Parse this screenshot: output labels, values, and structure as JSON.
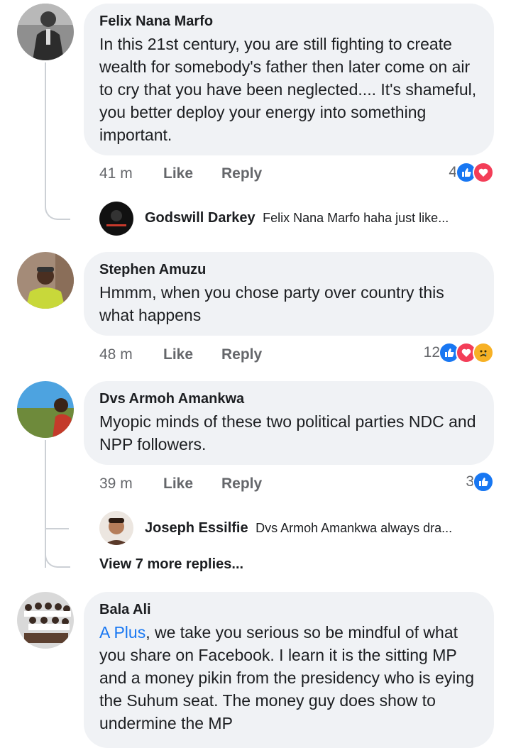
{
  "comments": [
    {
      "author": "Felix Nana Marfo",
      "text": "In this 21st century, you are still fighting to create wealth for somebody's father then later come on air to cry that you have been neglected.... It's shameful, you better deploy your energy into something important.",
      "time": "41 m",
      "like": "Like",
      "reply": "Reply",
      "reaction_count": "4",
      "reply_preview": {
        "author": "Godswill Darkey",
        "text": "Felix Nana Marfo haha just like..."
      }
    },
    {
      "author": "Stephen Amuzu",
      "text": "Hmmm, when you chose party over country this what happens",
      "time": "48 m",
      "like": "Like",
      "reply": "Reply",
      "reaction_count": "12"
    },
    {
      "author": "Dvs Armoh Amankwa",
      "text": "Myopic minds of these two political parties NDC and NPP followers.",
      "time": "39 m",
      "like": "Like",
      "reply": "Reply",
      "reaction_count": "3",
      "reply_preview": {
        "author": "Joseph Essilfie",
        "text": "Dvs Armoh Amankwa always dra..."
      },
      "more_replies": "View 7 more replies..."
    },
    {
      "author": "Bala Ali",
      "mention": "A Plus",
      "text": ", we take you serious so be mindful of what you share on Facebook. I learn it is the sitting MP and a money pikin from the presidency who is eying the Suhum seat. The money guy does show to undermine the MP"
    }
  ],
  "colors": {
    "bubble": "#f0f2f5",
    "link": "#1877f2",
    "like": "#1877f2",
    "love": "#f33e58",
    "sad": "#f7b125",
    "meta": "#65676b"
  },
  "icons": [
    "like-reaction-icon",
    "love-reaction-icon",
    "sad-reaction-icon"
  ]
}
